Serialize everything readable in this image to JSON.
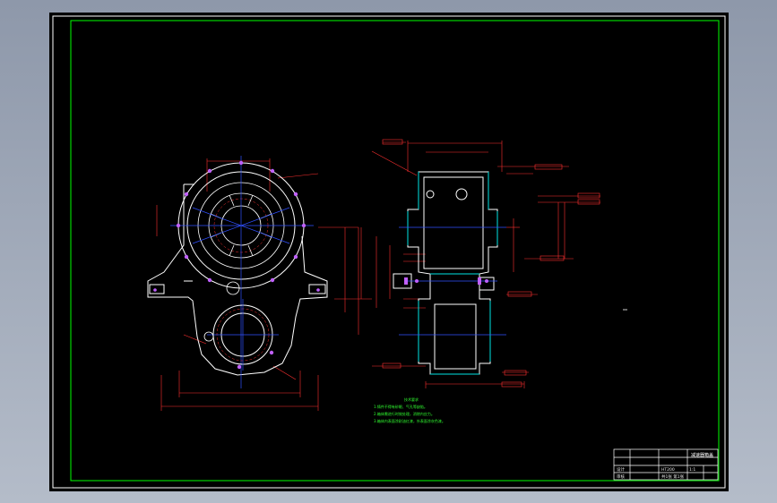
{
  "drawing": {
    "notes_heading": "技术要求",
    "notes": [
      "1.铸件不得有砂眼、气孔等缺陷。",
      "2.箱体需进行时效处理，消除内应力。",
      "3.箱体内表面涂耐油红漆，外表面涂灰色漆。"
    ],
    "title_block": {
      "drawing_title": "减速器箱盖",
      "scale": "1:1",
      "material": "HT200",
      "designer": "设计",
      "checker": "审核",
      "sheet": "共1张 第1张"
    }
  },
  "colors": {
    "background": "#000000",
    "outline": "#ffffff",
    "dimension": "#ff3030",
    "centerline": "#3050ff",
    "hole": "#c060ff",
    "notes": "#30ff30",
    "frame": "#00ff00",
    "hatch": "#00e5e5"
  }
}
